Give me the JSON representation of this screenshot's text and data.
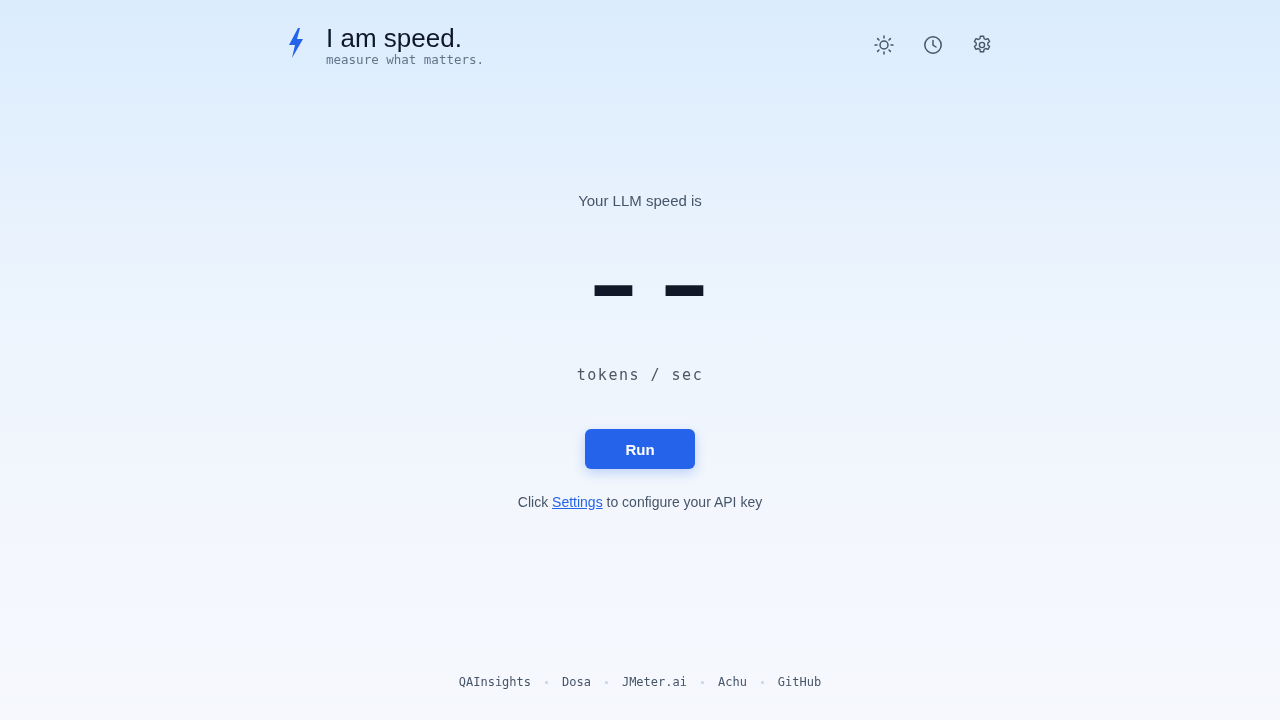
{
  "header": {
    "title": "I am speed.",
    "tagline": "measure what matters.",
    "actions": [
      {
        "kind": "theme"
      },
      {
        "kind": "history"
      },
      {
        "kind": "settings"
      }
    ]
  },
  "speed": {
    "label": "Your LLM speed is",
    "value": "--",
    "unit": "tokens / sec"
  },
  "run_button": {
    "label": "Run"
  },
  "hint": {
    "before": "Click",
    "link": "Settings",
    "after": "to configure your API key"
  },
  "footer": {
    "links": [
      "QAInsights",
      "Dosa",
      "JMeter.ai",
      "Achu",
      "GitHub"
    ]
  }
}
